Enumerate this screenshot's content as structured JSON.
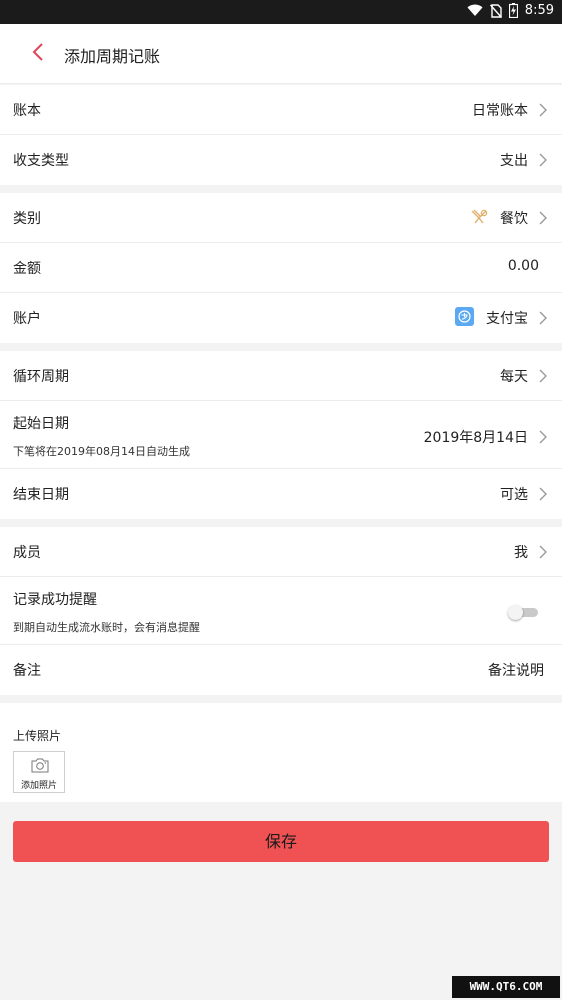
{
  "status_bar": {
    "time": "8:59",
    "icons": [
      "wifi-icon",
      "no-sim-icon",
      "battery-charging-icon"
    ]
  },
  "header": {
    "back_icon": "chevron-left-icon",
    "title": "添加周期记账"
  },
  "group1": {
    "book": {
      "label": "账本",
      "value": "日常账本"
    },
    "type": {
      "label": "收支类型",
      "value": "支出"
    }
  },
  "group2": {
    "category": {
      "label": "类别",
      "value": "餐饮",
      "icon": "dining-icon"
    },
    "amount": {
      "label": "金额",
      "value": "0.00"
    },
    "account": {
      "label": "账户",
      "value": "支付宝",
      "icon": "alipay-icon"
    }
  },
  "group3": {
    "cycle": {
      "label": "循环周期",
      "value": "每天"
    },
    "start": {
      "label": "起始日期",
      "value": "2019年8月14日",
      "note": "下笔将在2019年08月14日自动生成"
    },
    "end": {
      "label": "结束日期",
      "value": "可选"
    }
  },
  "group4": {
    "member": {
      "label": "成员",
      "value": "我"
    },
    "reminder": {
      "label": "记录成功提醒",
      "note": "到期自动生成流水账时，会有消息提醒",
      "enabled": false
    },
    "remark": {
      "label": "备注",
      "value": "备注说明"
    }
  },
  "upload": {
    "label": "上传照片",
    "add_label": "添加照片"
  },
  "save_button": "保存",
  "watermark": "WWW.QT6.COM",
  "colors": {
    "accent": "#f05254",
    "back_arrow": "#e0455b",
    "status_bar": "#1b1b1b",
    "alipay": "#5aa9f2",
    "dining_icon": "#e0b06a"
  }
}
